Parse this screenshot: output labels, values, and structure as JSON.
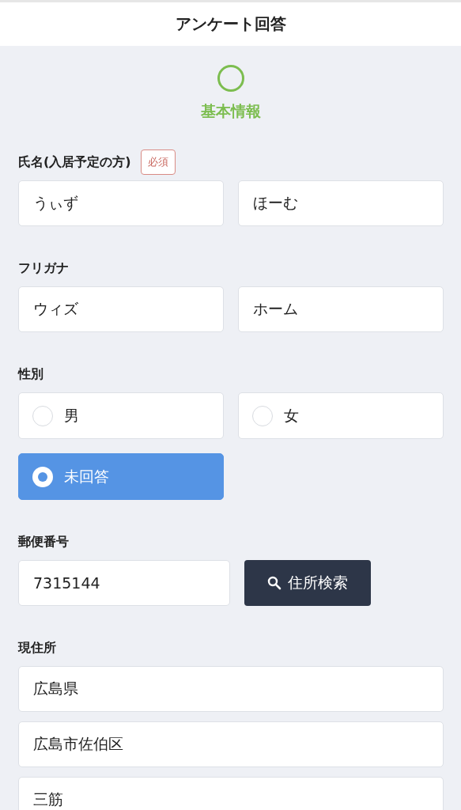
{
  "header": {
    "title": "アンケート回答"
  },
  "step": {
    "label": "基本情報"
  },
  "sections": [
    {
      "kind": "text_pair",
      "label": "氏名(入居予定の方)",
      "badge": "必須",
      "values": [
        "うぃず",
        "ほーむ"
      ]
    },
    {
      "kind": "text_pair",
      "label": "フリガナ",
      "values": [
        "ウィズ",
        "ホーム"
      ]
    },
    {
      "kind": "radio",
      "label": "性別",
      "options": [
        {
          "label": "男",
          "selected": false
        },
        {
          "label": "女",
          "selected": false
        },
        {
          "label": "未回答",
          "selected": true
        }
      ]
    },
    {
      "kind": "postal",
      "label": "郵便番号",
      "value": "7315144",
      "button": "住所検索"
    },
    {
      "kind": "address",
      "label": "現住所",
      "values": [
        "広島県",
        "広島市佐伯区",
        "三筋"
      ]
    }
  ]
}
